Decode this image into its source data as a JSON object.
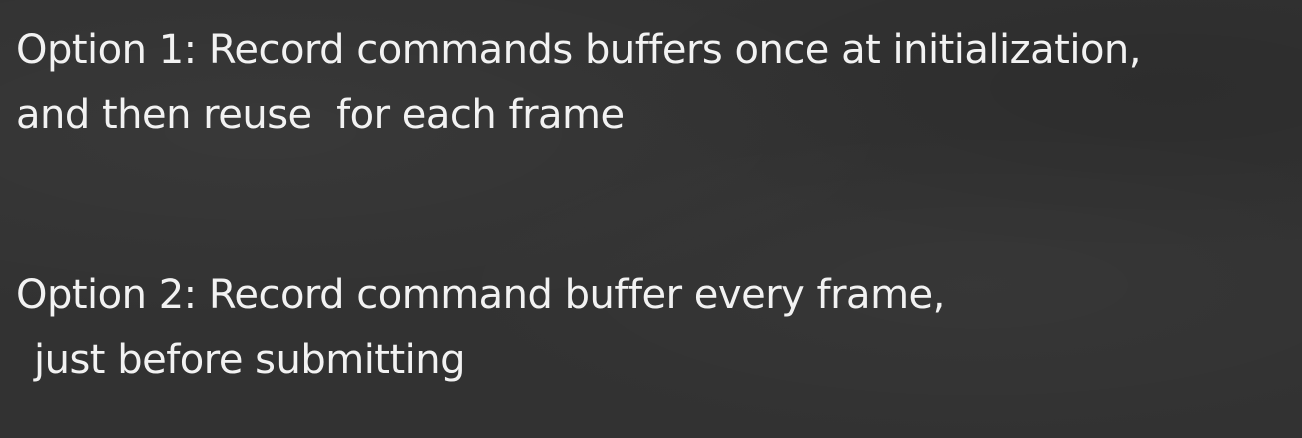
{
  "slide": {
    "option1": {
      "line1": "Option 1: Record commands buffers once at initialization,",
      "line2": "and then reuse  for each frame"
    },
    "option2": {
      "line1": "Option 2: Record command buffer every frame,",
      "line2": "just before submitting"
    },
    "background_color": "#323232",
    "text_color": "#f2f2f2"
  }
}
